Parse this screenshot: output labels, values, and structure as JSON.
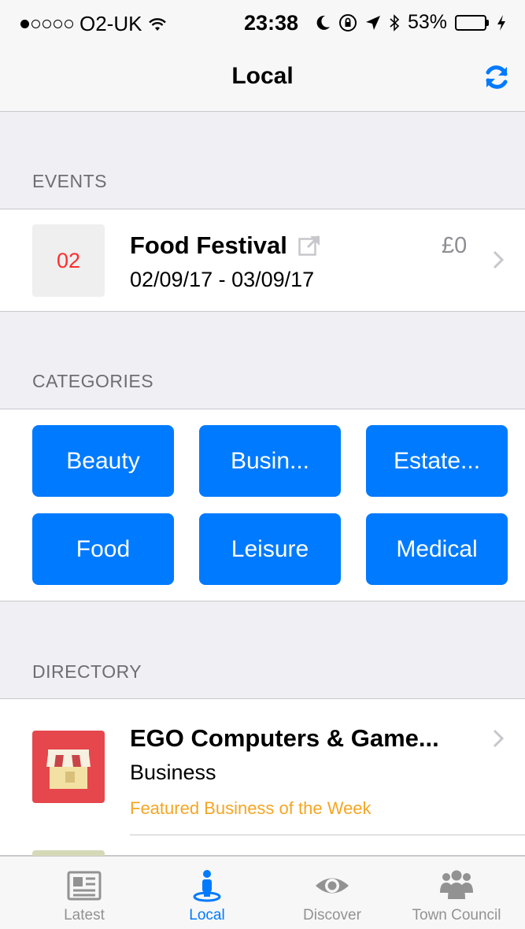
{
  "status_bar": {
    "carrier": "O2-UK",
    "time": "23:38",
    "battery_percent": "53%",
    "battery_level": 0.53,
    "signal_bars_filled": 1
  },
  "nav": {
    "title": "Local",
    "refresh_icon": "refresh-icon"
  },
  "events": {
    "header": "EVENTS",
    "items": [
      {
        "day": "02",
        "title": "Food Festival",
        "dates": "02/09/17 - 03/09/17",
        "price": "£0"
      }
    ]
  },
  "categories": {
    "header": "CATEGORIES",
    "items": [
      "Beauty",
      "Busin...",
      "Estate...",
      "Food",
      "Leisure",
      "Medical"
    ]
  },
  "directory": {
    "header": "DIRECTORY",
    "items": [
      {
        "title": "EGO Computers & Game...",
        "category": "Business",
        "featured": "Featured Business of the Week"
      }
    ]
  },
  "tabs": [
    {
      "label": "Latest",
      "icon": "newspaper-icon",
      "active": false
    },
    {
      "label": "Local",
      "icon": "person-pin-icon",
      "active": true
    },
    {
      "label": "Discover",
      "icon": "eye-icon",
      "active": false
    },
    {
      "label": "Town Council",
      "icon": "group-icon",
      "active": false
    }
  ],
  "colors": {
    "accent": "#007aff",
    "date_text": "#ff2d2d",
    "featured": "#f5a623",
    "directory_icon": "#e5474c"
  }
}
